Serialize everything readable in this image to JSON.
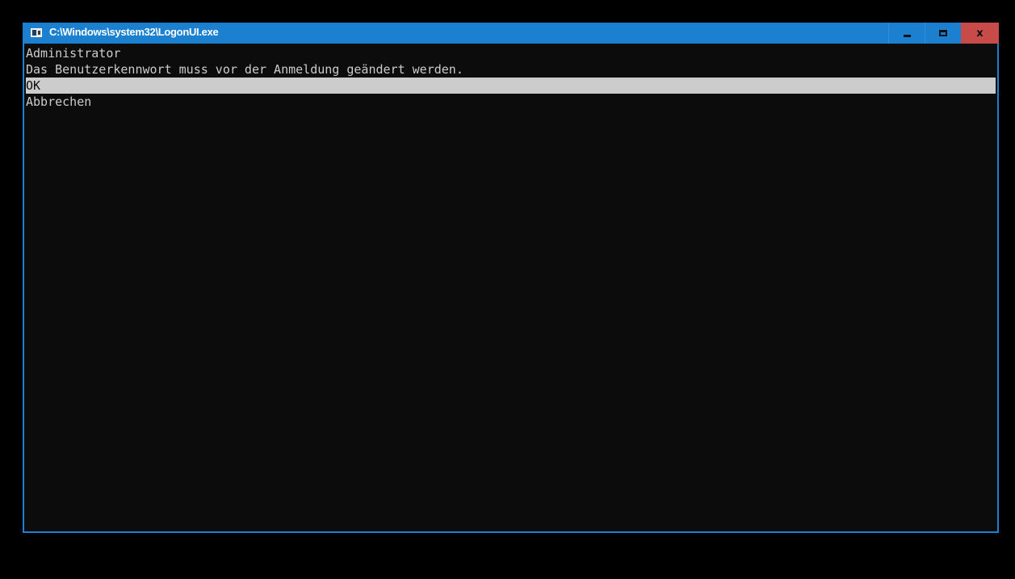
{
  "window": {
    "title": "C:\\Windows\\system32\\LogonUI.exe",
    "app_icon": "console-window-icon",
    "controls": {
      "minimize_icon": "minimize-icon",
      "maximize_icon": "maximize-icon",
      "close_icon": "close-icon",
      "close_glyph": "x"
    },
    "accent_color": "#1c80d0",
    "close_color": "#c74c49"
  },
  "console": {
    "username": "Administrator",
    "message": "Das Benutzerkennwort muss vor der Anmeldung geändert werden.",
    "options": [
      {
        "label": "OK",
        "selected": true
      },
      {
        "label": "Abbrechen",
        "selected": false
      }
    ]
  }
}
